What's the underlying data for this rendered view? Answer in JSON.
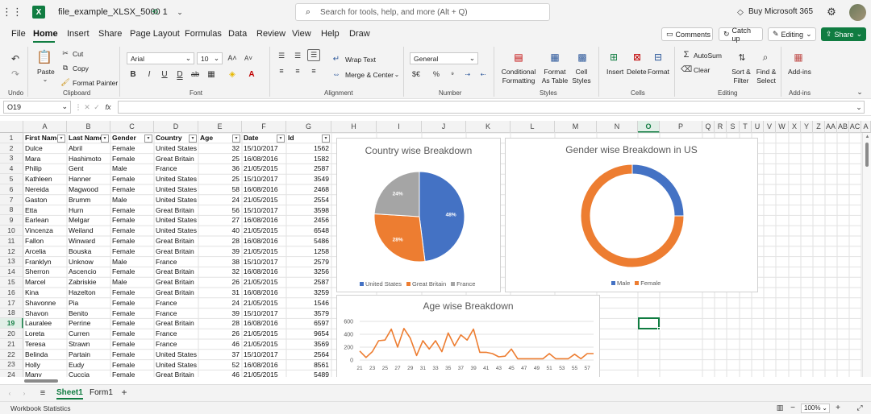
{
  "titlebar": {
    "app_icon": "excel-icon",
    "file_name": "file_example_XLSX_5000 1",
    "search_placeholder": "Search for tools, help, and more (Alt + Q)",
    "buy_label": "Buy Microsoft 365"
  },
  "menu": {
    "items": [
      "File",
      "Home",
      "Insert",
      "Share",
      "Page Layout",
      "Formulas",
      "Data",
      "Review",
      "View",
      "Help",
      "Draw"
    ],
    "active": "Home",
    "comments": "Comments",
    "catchup": "Catch up",
    "editing": "Editing",
    "share": "Share"
  },
  "ribbon": {
    "undo_group": "Undo",
    "clipboard_group": "Clipboard",
    "paste": "Paste",
    "cut": "Cut",
    "copy": "Copy",
    "format_painter": "Format Painter",
    "font_group": "Font",
    "font_name": "Arial",
    "font_size": "10",
    "alignment_group": "Alignment",
    "wrap_text": "Wrap Text",
    "merge_center": "Merge & Center",
    "number_group": "Number",
    "number_format": "General",
    "styles_group": "Styles",
    "conditional_formatting": "Conditional Formatting",
    "format_as_table": "Format As Table",
    "cell_styles": "Cell Styles",
    "cells_group": "Cells",
    "insert": "Insert",
    "delete": "Delete",
    "format": "Format",
    "editing_group": "Editing",
    "autosum": "AutoSum",
    "clear": "Clear",
    "sort_filter": "Sort & Filter",
    "find_select": "Find & Select",
    "addins_group": "Add-ins",
    "addins": "Add-ins"
  },
  "formula": {
    "name_box": "O19",
    "value": ""
  },
  "columns": [
    "A",
    "B",
    "C",
    "D",
    "E",
    "F",
    "G",
    "H",
    "I",
    "J",
    "K",
    "L",
    "M",
    "N",
    "O",
    "P",
    "Q",
    "R",
    "S",
    "T",
    "U",
    "V",
    "W",
    "X",
    "Y",
    "Z",
    "AA",
    "AB",
    "AC",
    "A"
  ],
  "selected_column": "O",
  "selected_row": "19",
  "header_row": [
    "First Name",
    "Last Name",
    "Gender",
    "Country",
    "Age",
    "Date",
    "Id"
  ],
  "rows": [
    [
      "Dulce",
      "Abril",
      "Female",
      "United States",
      "32",
      "15/10/2017",
      "1562"
    ],
    [
      "Mara",
      "Hashimoto",
      "Female",
      "Great Britain",
      "25",
      "16/08/2016",
      "1582"
    ],
    [
      "Philip",
      "Gent",
      "Male",
      "France",
      "36",
      "21/05/2015",
      "2587"
    ],
    [
      "Kathleen",
      "Hanner",
      "Female",
      "United States",
      "25",
      "15/10/2017",
      "3549"
    ],
    [
      "Nereida",
      "Magwood",
      "Female",
      "United States",
      "58",
      "16/08/2016",
      "2468"
    ],
    [
      "Gaston",
      "Brumm",
      "Male",
      "United States",
      "24",
      "21/05/2015",
      "2554"
    ],
    [
      "Etta",
      "Hurn",
      "Female",
      "Great Britain",
      "56",
      "15/10/2017",
      "3598"
    ],
    [
      "Earlean",
      "Melgar",
      "Female",
      "United States",
      "27",
      "16/08/2016",
      "2456"
    ],
    [
      "Vincenza",
      "Weiland",
      "Female",
      "United States",
      "40",
      "21/05/2015",
      "6548"
    ],
    [
      "Fallon",
      "Winward",
      "Female",
      "Great Britain",
      "28",
      "16/08/2016",
      "5486"
    ],
    [
      "Arcelia",
      "Bouska",
      "Female",
      "Great Britain",
      "39",
      "21/05/2015",
      "1258"
    ],
    [
      "Franklyn",
      "Unknow",
      "Male",
      "France",
      "38",
      "15/10/2017",
      "2579"
    ],
    [
      "Sherron",
      "Ascencio",
      "Female",
      "Great Britain",
      "32",
      "16/08/2016",
      "3256"
    ],
    [
      "Marcel",
      "Zabriskie",
      "Male",
      "Great Britain",
      "26",
      "21/05/2015",
      "2587"
    ],
    [
      "Kina",
      "Hazelton",
      "Female",
      "Great Britain",
      "31",
      "16/08/2016",
      "3259"
    ],
    [
      "Shavonne",
      "Pia",
      "Female",
      "France",
      "24",
      "21/05/2015",
      "1546"
    ],
    [
      "Shavon",
      "Benito",
      "Female",
      "France",
      "39",
      "15/10/2017",
      "3579"
    ],
    [
      "Lauralee",
      "Perrine",
      "Female",
      "Great Britain",
      "28",
      "16/08/2016",
      "6597"
    ],
    [
      "Loreta",
      "Curren",
      "Female",
      "France",
      "26",
      "21/05/2015",
      "9654"
    ],
    [
      "Teresa",
      "Strawn",
      "Female",
      "France",
      "46",
      "21/05/2015",
      "3569"
    ],
    [
      "Belinda",
      "Partain",
      "Female",
      "United States",
      "37",
      "15/10/2017",
      "2564"
    ],
    [
      "Holly",
      "Eudy",
      "Female",
      "United States",
      "52",
      "16/08/2016",
      "8561"
    ],
    [
      "Many",
      "Cuccia",
      "Female",
      "Great Britain",
      "46",
      "21/05/2015",
      "5489"
    ]
  ],
  "sheets": {
    "tabs": [
      "Sheet1",
      "Form1"
    ],
    "active": "Sheet1"
  },
  "status": {
    "workbook_statistics": "Workbook Statistics",
    "zoom": "100%"
  },
  "colors": {
    "us": "#4472c4",
    "gb": "#ed7d31",
    "fr": "#a5a5a5",
    "excel_green": "#107c41",
    "selection": "#107c41"
  },
  "chart_data": [
    {
      "type": "pie",
      "title": "Country wise Breakdown",
      "categories": [
        "United States",
        "Great Britain",
        "France"
      ],
      "values": [
        48,
        28,
        24
      ],
      "labels": [
        "48%",
        "28%",
        "24%"
      ],
      "legend": "bottom"
    },
    {
      "type": "pie",
      "subtype": "doughnut",
      "title": "Gender wise Breakdown in US",
      "categories": [
        "Male",
        "Female"
      ],
      "values": [
        25,
        75
      ],
      "legend": "bottom"
    },
    {
      "type": "line",
      "title": "Age wise Breakdown",
      "x_ticks": [
        "21",
        "23",
        "25",
        "27",
        "29",
        "31",
        "33",
        "35",
        "37",
        "39",
        "41",
        "43",
        "45",
        "47",
        "49",
        "51",
        "53",
        "55",
        "57"
      ],
      "y_ticks": [
        "0",
        "200",
        "400",
        "600"
      ],
      "ylim": [
        0,
        600
      ],
      "x": [
        21,
        22,
        23,
        24,
        25,
        26,
        27,
        28,
        29,
        30,
        31,
        32,
        33,
        34,
        35,
        36,
        37,
        38,
        39,
        40,
        41,
        42,
        43,
        44,
        45,
        46,
        47,
        48,
        49,
        50,
        51,
        52,
        53,
        54,
        55,
        56,
        57,
        58
      ],
      "y": [
        140,
        40,
        130,
        300,
        310,
        480,
        200,
        490,
        340,
        70,
        300,
        170,
        300,
        130,
        420,
        220,
        390,
        310,
        480,
        120,
        120,
        100,
        50,
        60,
        170,
        20,
        20,
        20,
        20,
        20,
        100,
        20,
        20,
        20,
        90,
        20,
        100,
        100
      ],
      "grid": "horizontal"
    }
  ]
}
